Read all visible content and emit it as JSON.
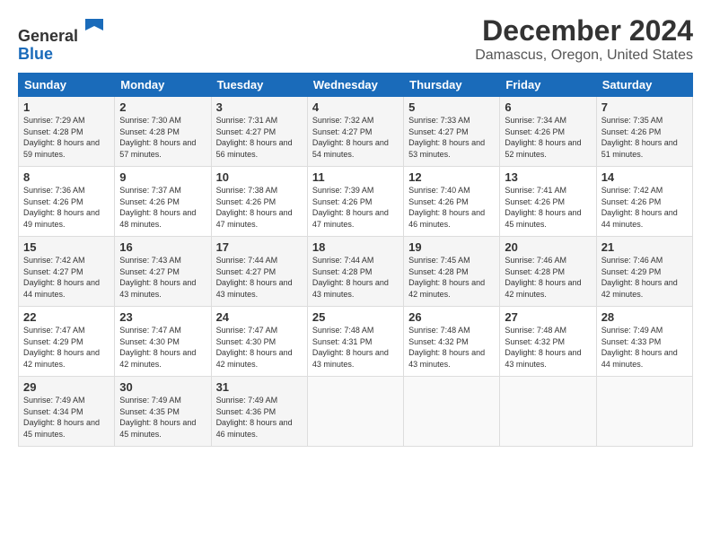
{
  "header": {
    "logo_general": "General",
    "logo_blue": "Blue",
    "title": "December 2024",
    "subtitle": "Damascus, Oregon, United States"
  },
  "calendar": {
    "weekdays": [
      "Sunday",
      "Monday",
      "Tuesday",
      "Wednesday",
      "Thursday",
      "Friday",
      "Saturday"
    ],
    "weeks": [
      [
        {
          "day": "1",
          "sunrise": "7:29 AM",
          "sunset": "4:28 PM",
          "daylight": "8 hours and 59 minutes."
        },
        {
          "day": "2",
          "sunrise": "7:30 AM",
          "sunset": "4:28 PM",
          "daylight": "8 hours and 57 minutes."
        },
        {
          "day": "3",
          "sunrise": "7:31 AM",
          "sunset": "4:27 PM",
          "daylight": "8 hours and 56 minutes."
        },
        {
          "day": "4",
          "sunrise": "7:32 AM",
          "sunset": "4:27 PM",
          "daylight": "8 hours and 54 minutes."
        },
        {
          "day": "5",
          "sunrise": "7:33 AM",
          "sunset": "4:27 PM",
          "daylight": "8 hours and 53 minutes."
        },
        {
          "day": "6",
          "sunrise": "7:34 AM",
          "sunset": "4:26 PM",
          "daylight": "8 hours and 52 minutes."
        },
        {
          "day": "7",
          "sunrise": "7:35 AM",
          "sunset": "4:26 PM",
          "daylight": "8 hours and 51 minutes."
        }
      ],
      [
        {
          "day": "8",
          "sunrise": "7:36 AM",
          "sunset": "4:26 PM",
          "daylight": "8 hours and 49 minutes."
        },
        {
          "day": "9",
          "sunrise": "7:37 AM",
          "sunset": "4:26 PM",
          "daylight": "8 hours and 48 minutes."
        },
        {
          "day": "10",
          "sunrise": "7:38 AM",
          "sunset": "4:26 PM",
          "daylight": "8 hours and 47 minutes."
        },
        {
          "day": "11",
          "sunrise": "7:39 AM",
          "sunset": "4:26 PM",
          "daylight": "8 hours and 47 minutes."
        },
        {
          "day": "12",
          "sunrise": "7:40 AM",
          "sunset": "4:26 PM",
          "daylight": "8 hours and 46 minutes."
        },
        {
          "day": "13",
          "sunrise": "7:41 AM",
          "sunset": "4:26 PM",
          "daylight": "8 hours and 45 minutes."
        },
        {
          "day": "14",
          "sunrise": "7:42 AM",
          "sunset": "4:26 PM",
          "daylight": "8 hours and 44 minutes."
        }
      ],
      [
        {
          "day": "15",
          "sunrise": "7:42 AM",
          "sunset": "4:27 PM",
          "daylight": "8 hours and 44 minutes."
        },
        {
          "day": "16",
          "sunrise": "7:43 AM",
          "sunset": "4:27 PM",
          "daylight": "8 hours and 43 minutes."
        },
        {
          "day": "17",
          "sunrise": "7:44 AM",
          "sunset": "4:27 PM",
          "daylight": "8 hours and 43 minutes."
        },
        {
          "day": "18",
          "sunrise": "7:44 AM",
          "sunset": "4:28 PM",
          "daylight": "8 hours and 43 minutes."
        },
        {
          "day": "19",
          "sunrise": "7:45 AM",
          "sunset": "4:28 PM",
          "daylight": "8 hours and 42 minutes."
        },
        {
          "day": "20",
          "sunrise": "7:46 AM",
          "sunset": "4:28 PM",
          "daylight": "8 hours and 42 minutes."
        },
        {
          "day": "21",
          "sunrise": "7:46 AM",
          "sunset": "4:29 PM",
          "daylight": "8 hours and 42 minutes."
        }
      ],
      [
        {
          "day": "22",
          "sunrise": "7:47 AM",
          "sunset": "4:29 PM",
          "daylight": "8 hours and 42 minutes."
        },
        {
          "day": "23",
          "sunrise": "7:47 AM",
          "sunset": "4:30 PM",
          "daylight": "8 hours and 42 minutes."
        },
        {
          "day": "24",
          "sunrise": "7:47 AM",
          "sunset": "4:30 PM",
          "daylight": "8 hours and 42 minutes."
        },
        {
          "day": "25",
          "sunrise": "7:48 AM",
          "sunset": "4:31 PM",
          "daylight": "8 hours and 43 minutes."
        },
        {
          "day": "26",
          "sunrise": "7:48 AM",
          "sunset": "4:32 PM",
          "daylight": "8 hours and 43 minutes."
        },
        {
          "day": "27",
          "sunrise": "7:48 AM",
          "sunset": "4:32 PM",
          "daylight": "8 hours and 43 minutes."
        },
        {
          "day": "28",
          "sunrise": "7:49 AM",
          "sunset": "4:33 PM",
          "daylight": "8 hours and 44 minutes."
        }
      ],
      [
        {
          "day": "29",
          "sunrise": "7:49 AM",
          "sunset": "4:34 PM",
          "daylight": "8 hours and 45 minutes."
        },
        {
          "day": "30",
          "sunrise": "7:49 AM",
          "sunset": "4:35 PM",
          "daylight": "8 hours and 45 minutes."
        },
        {
          "day": "31",
          "sunrise": "7:49 AM",
          "sunset": "4:36 PM",
          "daylight": "8 hours and 46 minutes."
        },
        null,
        null,
        null,
        null
      ]
    ]
  }
}
